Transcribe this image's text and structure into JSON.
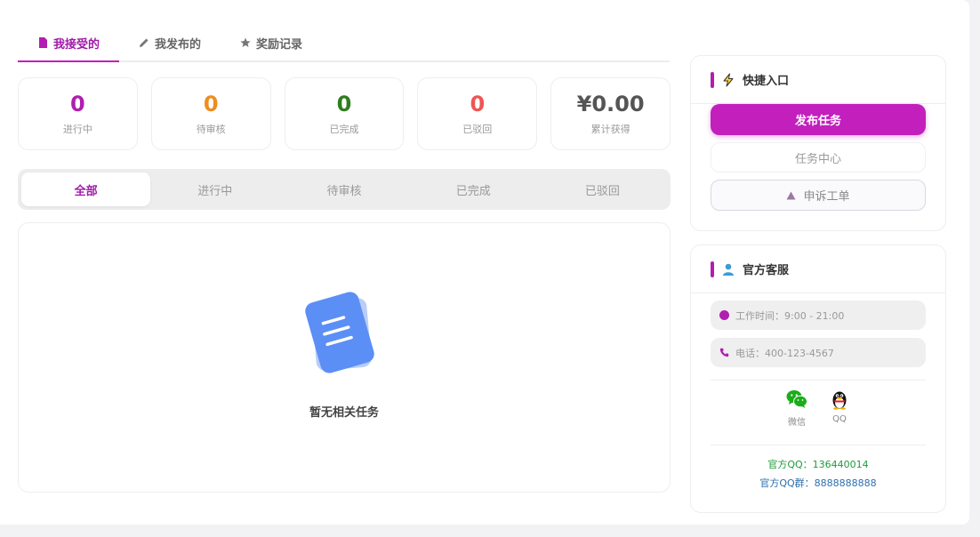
{
  "tabs": [
    {
      "label": "我接受的",
      "icon": "document-icon"
    },
    {
      "label": "我发布的",
      "icon": "pencil-icon"
    },
    {
      "label": "奖励记录",
      "icon": "star-icon"
    }
  ],
  "stats": [
    {
      "value": "0",
      "label": "进行中",
      "color": "#b01fb0"
    },
    {
      "value": "0",
      "label": "待审核",
      "color": "#f08c1e"
    },
    {
      "value": "0",
      "label": "已完成",
      "color": "#2e7d1f"
    },
    {
      "value": "0",
      "label": "已驳回",
      "color": "#f05454"
    },
    {
      "value": "¥0.00",
      "label": "累计获得",
      "color": "#555555"
    }
  ],
  "filters": [
    "全部",
    "进行中",
    "待审核",
    "已完成",
    "已驳回"
  ],
  "empty": {
    "text": "暂无相关任务",
    "icon": "document-empty-icon"
  },
  "quick": {
    "title": "快捷入口",
    "icon": "lightning-icon",
    "publish": "发布任务",
    "center": "任务中心",
    "appeal": "申诉工单"
  },
  "service": {
    "title": "官方客服",
    "icon": "user-icon",
    "hours": "工作时间：9:00 - 21:00",
    "phone": "电话：400-123-4567",
    "wechat": "微信",
    "qq": "QQ",
    "qq_official": "官方QQ：136440014",
    "qq_group": "官方QQ群：8888888888"
  },
  "colors": {
    "accent": "#c21fbd",
    "accent_dark": "#a01aa8"
  }
}
